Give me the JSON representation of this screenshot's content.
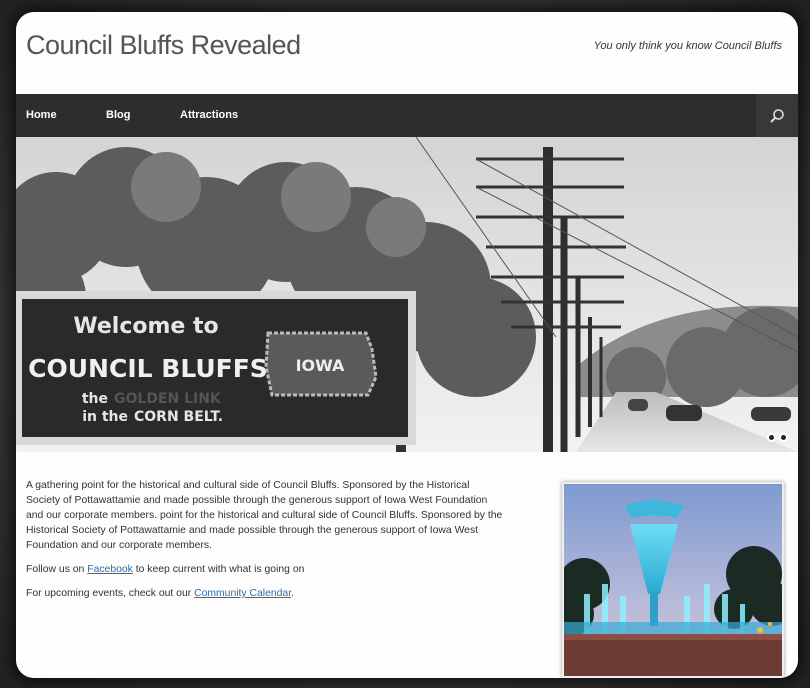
{
  "site": {
    "title": "Council Bluffs Revealed",
    "tagline": "You only think you know Council Bluffs"
  },
  "nav": {
    "items": [
      {
        "label": "Home"
      },
      {
        "label": "Blog"
      },
      {
        "label": "Attractions"
      }
    ],
    "search_icon": "search-icon"
  },
  "hero": {
    "sign_line1": "Welcome to",
    "sign_line2": "COUNCIL BLUFFS",
    "sign_line3a": "the",
    "sign_line3b": "GOLDEN LINK",
    "sign_line4a": "in the",
    "sign_line4b": "CORN BELT.",
    "state_label": "IOWA",
    "slides": 2
  },
  "content": {
    "intro": "A gathering point for the historical and cultural side of Council Bluffs. Sponsored by the Historical Society of Pottawattamie and made possible through the generous support of Iowa West Foundation and our corporate members. point for the historical and cultural side of Council Bluffs. Sponsored by the Historical Society of Pottawattamie and made possible through the generous support of Iowa West Foundation and our corporate members.",
    "follow_prefix": "Follow us on ",
    "follow_link": "Facebook",
    "follow_suffix": " to keep current with what is going on",
    "events_prefix": "For upcoming events, check out our ",
    "events_link": "Community Calendar",
    "events_suffix": "."
  },
  "colors": {
    "nav_bg": "#2b2d2f",
    "link": "#2a6db1",
    "fountain_glow": "#4fd6f0"
  }
}
